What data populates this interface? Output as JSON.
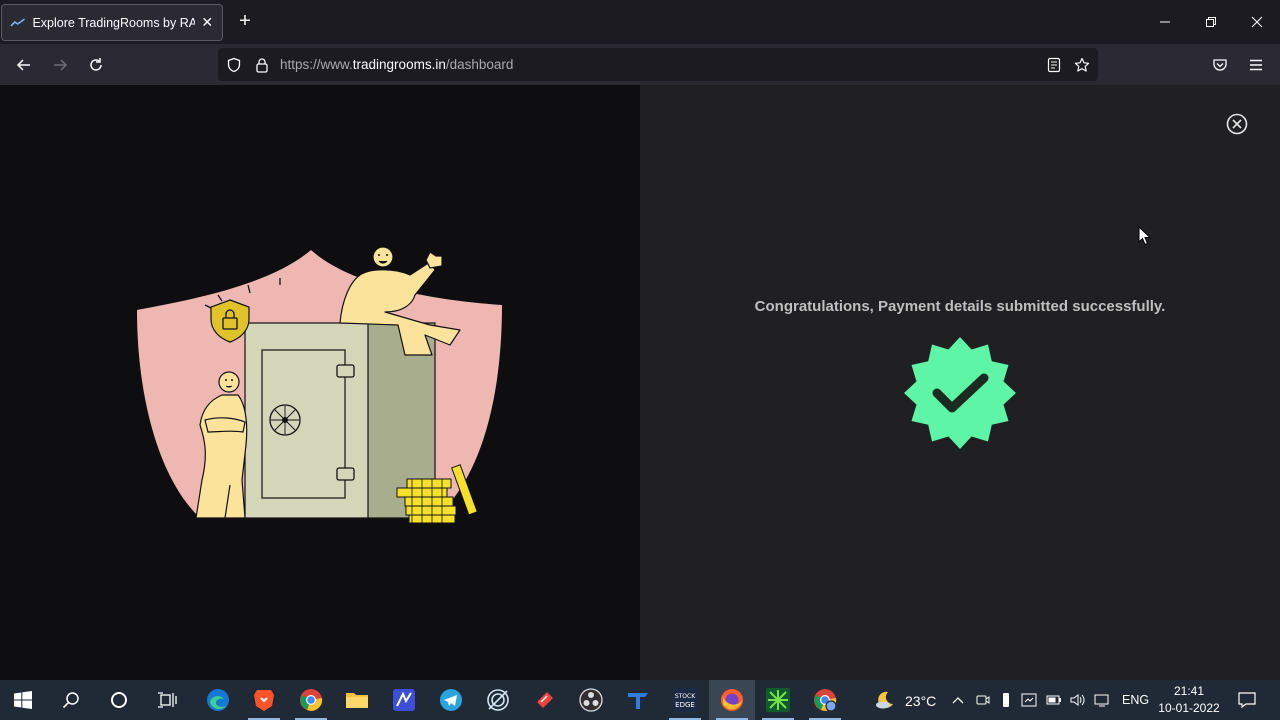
{
  "browser": {
    "tab": {
      "title": "Explore TradingRooms by RAIN"
    },
    "url": {
      "scheme": "https://www.",
      "host": "tradingrooms.in",
      "path": "/dashboard"
    }
  },
  "modal": {
    "message": "Congratulations, Payment details submitted successfully.",
    "badge_color": "#5ef5a6"
  },
  "colors": {
    "shield": "#efb7b1",
    "figure": "#fbe39c",
    "safe_front": "#d3d6b9",
    "safe_side": "#a8ad8e",
    "coins": "#f5e12a"
  },
  "taskbar": {
    "apps": [
      {
        "name": "Microsoft Edge"
      },
      {
        "name": "Brave"
      },
      {
        "name": "Google Chrome"
      },
      {
        "name": "File Explorer"
      },
      {
        "name": "Notes"
      },
      {
        "name": "Telegram"
      },
      {
        "name": "Cast"
      },
      {
        "name": "AnyDesk"
      },
      {
        "name": "OBS Studio"
      },
      {
        "name": "Trading Terminal"
      },
      {
        "name": "StockEdge"
      },
      {
        "name": "Firefox"
      },
      {
        "name": "Pi Trading"
      },
      {
        "name": "Chrome Profile"
      }
    ],
    "weather": "23°C",
    "language": "ENG",
    "time": "21:41",
    "date": "10-01-2022"
  }
}
